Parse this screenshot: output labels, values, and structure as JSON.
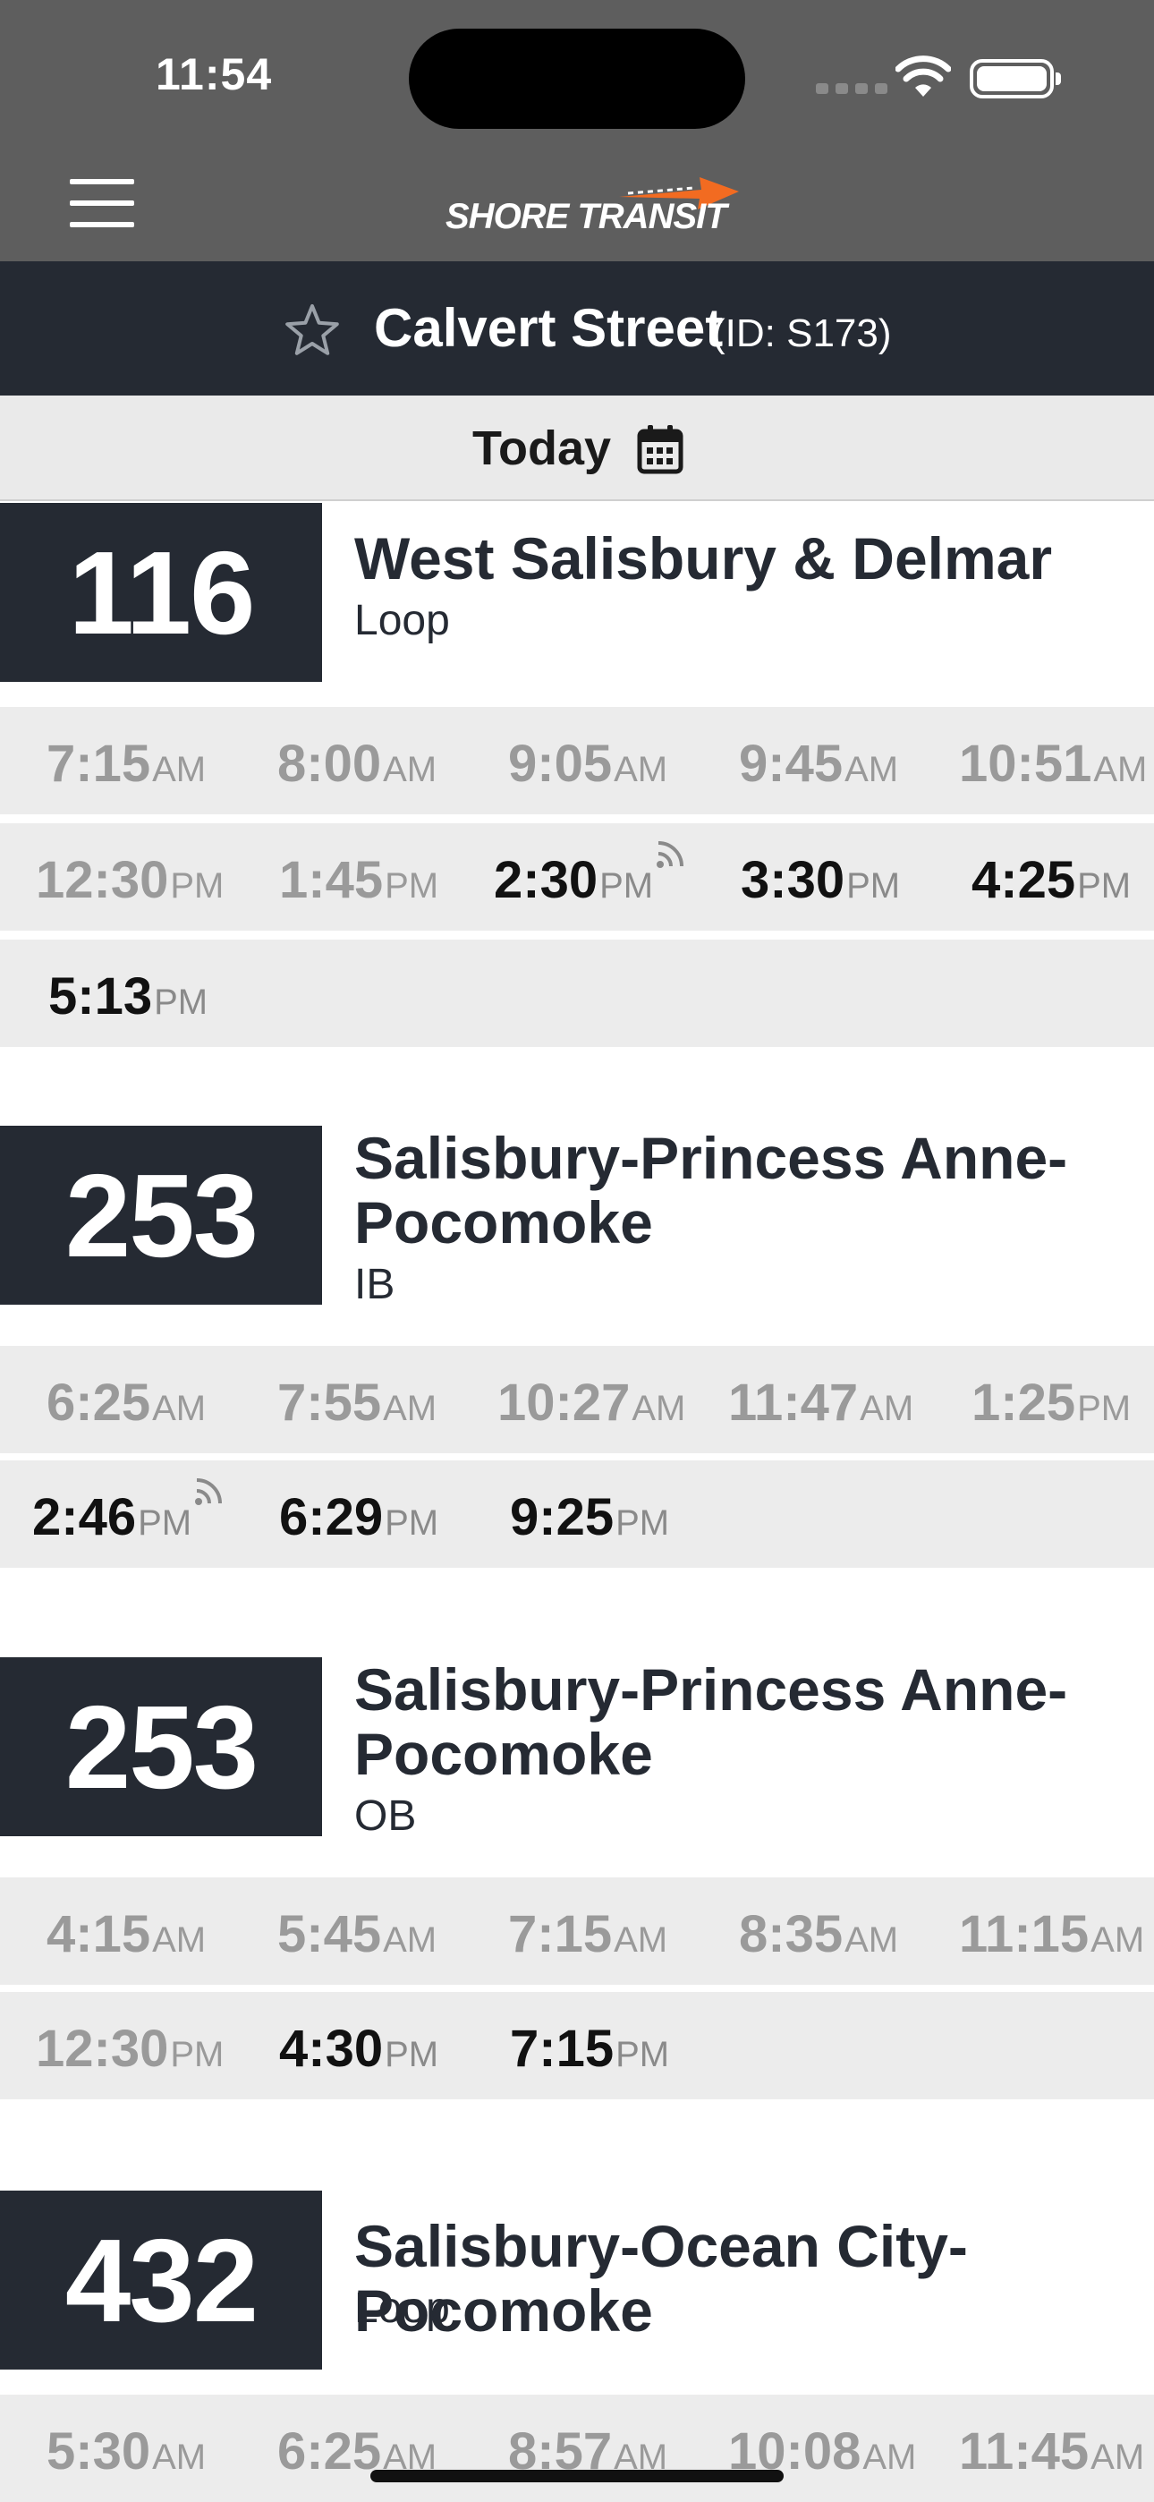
{
  "status_bar": {
    "time": "11:54"
  },
  "header": {
    "logo_text": "SHORE TRANSIT"
  },
  "stop": {
    "name": "Calvert Street",
    "id_label": "(ID: S173)"
  },
  "date_selector": {
    "label": "Today"
  },
  "colors": {
    "header_bg": "#5e5e5e",
    "stop_bar_bg": "#252a33",
    "badge_bg": "#252a33",
    "logo_accent": "#f26b21",
    "past_time": "#9a9a9a",
    "next_time": "#111111"
  },
  "routes": [
    {
      "number": "116",
      "name": "West Salisbury & Delmar",
      "direction": "Loop",
      "times": [
        {
          "t": "7:15",
          "p": "AM",
          "past": true
        },
        {
          "t": "8:00",
          "p": "AM",
          "past": true
        },
        {
          "t": "9:05",
          "p": "AM",
          "past": true
        },
        {
          "t": "9:45",
          "p": "AM",
          "past": true
        },
        {
          "t": "10:51",
          "p": "AM",
          "past": true
        },
        {
          "t": "12:30",
          "p": "PM",
          "past": true
        },
        {
          "t": "1:45",
          "p": "PM",
          "past": true
        },
        {
          "t": "2:30",
          "p": "PM",
          "past": false,
          "realtime": true
        },
        {
          "t": "3:30",
          "p": "PM",
          "past": false
        },
        {
          "t": "4:25",
          "p": "PM",
          "past": false
        },
        {
          "t": "5:13",
          "p": "PM",
          "past": false
        }
      ]
    },
    {
      "number": "253",
      "name": "Salisbury-Princess Anne-Pocomoke",
      "direction": "IB",
      "times": [
        {
          "t": "6:25",
          "p": "AM",
          "past": true
        },
        {
          "t": "7:55",
          "p": "AM",
          "past": true
        },
        {
          "t": "10:27",
          "p": "AM",
          "past": true
        },
        {
          "t": "11:47",
          "p": "AM",
          "past": true
        },
        {
          "t": "1:25",
          "p": "PM",
          "past": true
        },
        {
          "t": "2:46",
          "p": "PM",
          "past": false,
          "realtime": true
        },
        {
          "t": "6:29",
          "p": "PM",
          "past": false
        },
        {
          "t": "9:25",
          "p": "PM",
          "past": false
        }
      ]
    },
    {
      "number": "253",
      "name": "Salisbury-Princess Anne-Pocomoke",
      "direction": "OB",
      "times": [
        {
          "t": "4:15",
          "p": "AM",
          "past": true
        },
        {
          "t": "5:45",
          "p": "AM",
          "past": true
        },
        {
          "t": "7:15",
          "p": "AM",
          "past": true
        },
        {
          "t": "8:35",
          "p": "AM",
          "past": true
        },
        {
          "t": "11:15",
          "p": "AM",
          "past": true
        },
        {
          "t": "12:30",
          "p": "PM",
          "past": true
        },
        {
          "t": "4:30",
          "p": "PM",
          "past": false
        },
        {
          "t": "7:15",
          "p": "PM",
          "past": false
        }
      ]
    },
    {
      "number": "432",
      "name": "Salisbury-Ocean City-Pocomoke",
      "direction": "Loop",
      "times": [
        {
          "t": "5:30",
          "p": "AM",
          "past": true
        },
        {
          "t": "6:25",
          "p": "AM",
          "past": true
        },
        {
          "t": "8:57",
          "p": "AM",
          "past": true
        },
        {
          "t": "10:08",
          "p": "AM",
          "past": true
        },
        {
          "t": "11:45",
          "p": "AM",
          "past": true
        }
      ]
    }
  ]
}
